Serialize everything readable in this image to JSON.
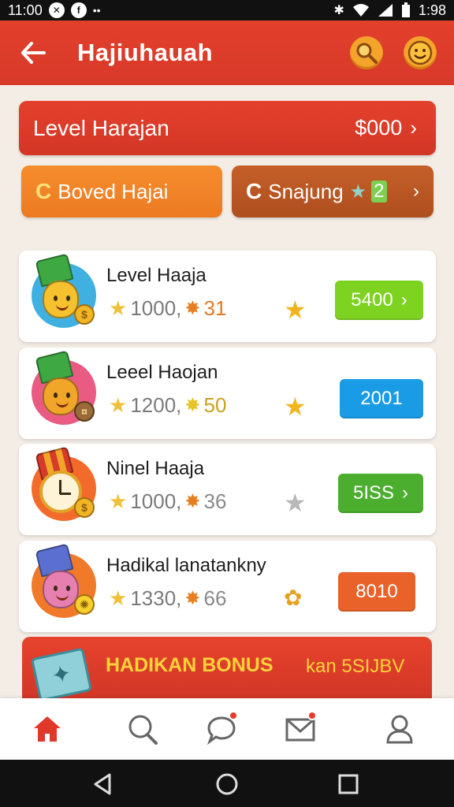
{
  "status_bar": {
    "time_left": "11:00",
    "time_right": "1:98"
  },
  "app_bar": {
    "title": "Hajiuhauah"
  },
  "level_banner": {
    "title": "Level Harajan",
    "value": "$000"
  },
  "action_buttons": [
    {
      "label": "Boved Hajai"
    },
    {
      "label": "Snajung",
      "badge": "2"
    }
  ],
  "cards": [
    {
      "title": "Level Haaja",
      "stat_a": "1000,",
      "stat_b": "31",
      "button": "5400",
      "button_color": "#7ed321"
    },
    {
      "title": "Leeel Haojan",
      "stat_a": "1200,",
      "stat_b": "50",
      "button": "2001",
      "button_color": "#1a9be6"
    },
    {
      "title": "Ninel Haaja",
      "stat_a": "1000,",
      "stat_b": "36",
      "button": "5ISS",
      "button_color": "#4cae2f"
    },
    {
      "title": "Hadikal lanatankny",
      "stat_a": "1330,",
      "stat_b": "66",
      "button": "8010",
      "button_color": "#e8622a"
    }
  ],
  "bonus": {
    "title": "HADIKAN BONUS",
    "subtitle": "kan 5SIJBV"
  },
  "bottom_nav": [
    {
      "icon": "home-icon",
      "active": true
    },
    {
      "icon": "search-icon",
      "active": false
    },
    {
      "icon": "chat-icon",
      "active": false
    },
    {
      "icon": "mail-icon",
      "active": false
    },
    {
      "icon": "profile-icon",
      "active": false
    }
  ],
  "colors": {
    "primary": "#dd3d2a",
    "accent_orange": "#f0852a",
    "accent_brown": "#b6552a",
    "star_gold": "#f0c03a"
  }
}
